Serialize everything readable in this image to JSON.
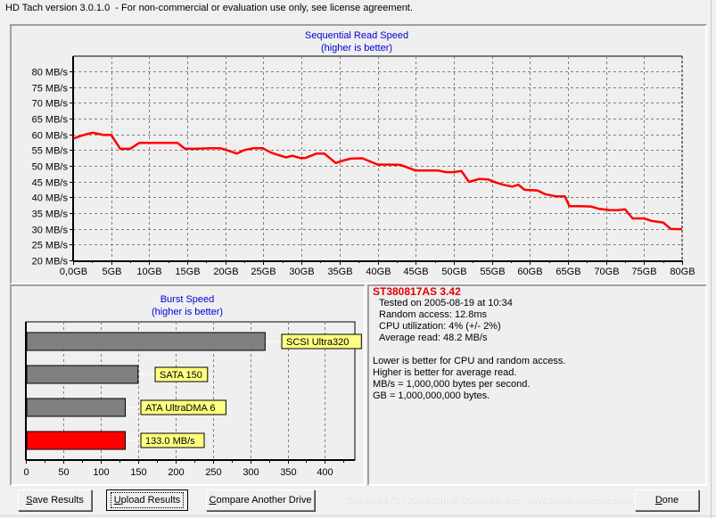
{
  "window": {
    "title": "HD Tach version 3.0.1.0  - For non-commercial or evaluation use only, see license agreement."
  },
  "chart_data": [
    {
      "type": "line",
      "title": "Sequential Read Speed",
      "subtitle": "(higher is better)",
      "xlabel": "",
      "ylabel": "",
      "xlim": [
        0,
        80
      ],
      "ylim": [
        20,
        80
      ],
      "grid": true,
      "x_tick_labels": [
        "0,0GB",
        "5GB",
        "10GB",
        "15GB",
        "20GB",
        "25GB",
        "30GB",
        "35GB",
        "40GB",
        "45GB",
        "50GB",
        "55GB",
        "60GB",
        "65GB",
        "70GB",
        "75GB",
        "80GB"
      ],
      "y_tick_labels": [
        "20 MB/s",
        "25 MB/s",
        "30 MB/s",
        "35 MB/s",
        "40 MB/s",
        "45 MB/s",
        "50 MB/s",
        "55 MB/s",
        "60 MB/s",
        "65 MB/s",
        "70 MB/s",
        "75 MB/s",
        "80 MB/s"
      ],
      "x_ticks": [
        0,
        5,
        10,
        15,
        20,
        25,
        30,
        35,
        40,
        45,
        50,
        55,
        60,
        65,
        70,
        75,
        80
      ],
      "y_ticks": [
        20,
        25,
        30,
        35,
        40,
        45,
        50,
        55,
        60,
        65,
        70,
        75,
        80
      ],
      "series": [
        {
          "name": "Sequential read",
          "color": "#ff0000",
          "x": [
            0,
            1,
            2,
            2.6,
            3,
            4,
            5,
            6.2,
            7.5,
            8.7,
            10,
            12,
            13.7,
            14.7,
            16,
            18,
            19.3,
            20.3,
            21.5,
            22.5,
            23.7,
            24.9,
            26,
            27,
            28,
            28.8,
            29.8,
            30.5,
            32,
            33,
            34.5,
            35.5,
            36.5,
            38,
            40,
            41.5,
            43,
            45,
            48,
            49,
            50,
            51,
            52,
            53.3,
            54.5,
            55.3,
            56.5,
            57.7,
            58.5,
            59.3,
            61,
            62,
            63.5,
            64.6,
            65.2,
            66.5,
            68,
            69,
            70.5,
            71.5,
            72.5,
            73.5,
            75,
            76,
            77.5,
            78.5,
            79.4,
            80
          ],
          "y": [
            58.6,
            59.5,
            60.2,
            60.5,
            60.3,
            59.8,
            59.8,
            55.4,
            55.4,
            57.3,
            57.3,
            57.3,
            57.3,
            55.4,
            55.4,
            55.6,
            55.6,
            54.9,
            53.9,
            55.0,
            55.6,
            55.6,
            54.2,
            53.4,
            52.7,
            53.2,
            52.5,
            52.5,
            53.9,
            53.9,
            50.9,
            51.7,
            52.3,
            52.4,
            50.4,
            50.4,
            50.3,
            48.5,
            48.5,
            48.0,
            48.0,
            48.4,
            44.9,
            45.8,
            45.7,
            44.9,
            44.0,
            43.4,
            44.0,
            42.4,
            42.2,
            41.0,
            40.3,
            40.3,
            37.2,
            37.2,
            37.1,
            36.4,
            35.9,
            35.9,
            36.2,
            33.3,
            33.3,
            32.5,
            32.0,
            30.0,
            29.9,
            29.9
          ]
        }
      ]
    },
    {
      "type": "bar",
      "orientation": "horizontal",
      "title": "Burst Speed",
      "subtitle": "(higher is better)",
      "xlim": [
        0,
        440
      ],
      "grid": true,
      "x_tick_labels": [
        "0",
        "50",
        "100",
        "150",
        "200",
        "250",
        "300",
        "350",
        "400"
      ],
      "x_ticks": [
        0,
        50,
        100,
        150,
        200,
        250,
        300,
        350,
        400
      ],
      "categories": [
        "SCSI Ultra320",
        "SATA 150",
        "ATA UltraDMA 6",
        "133.0 MB/s"
      ],
      "values": [
        320,
        150,
        133,
        133
      ],
      "colors": [
        "#808080",
        "#808080",
        "#808080",
        "#ff0000"
      ],
      "label_background": "#ffff80"
    }
  ],
  "info": {
    "drive": "ST380817AS 3.42",
    "lines": [
      "Tested on 2005-08-19 at 10:34",
      "Random access: 12.8ms",
      "CPU utilization: 4% (+/- 2%)",
      "Average read: 48.2 MB/s"
    ],
    "notes": [
      "Lower is better for CPU and random access.",
      "Higher is better for average read.",
      "MB/s = 1,000,000 bytes per second.",
      "GB = 1,000,000,000 bytes."
    ]
  },
  "buttons": {
    "save": {
      "mnemonic": "S",
      "rest": "ave Results"
    },
    "upload": {
      "mnemonic": "U",
      "rest": "pload Results"
    },
    "compare": {
      "mnemonic": "C",
      "rest": "ompare Another Drive"
    },
    "done": {
      "mnemonic": "D",
      "rest": "one"
    }
  },
  "copyright": "Copyright (C) 2004 Simpli Software, Inc. www.simplisoftware.com",
  "colors": {
    "accent_title": "#0000d8",
    "drive_name": "#e00000",
    "series_line": "#ff0000"
  }
}
